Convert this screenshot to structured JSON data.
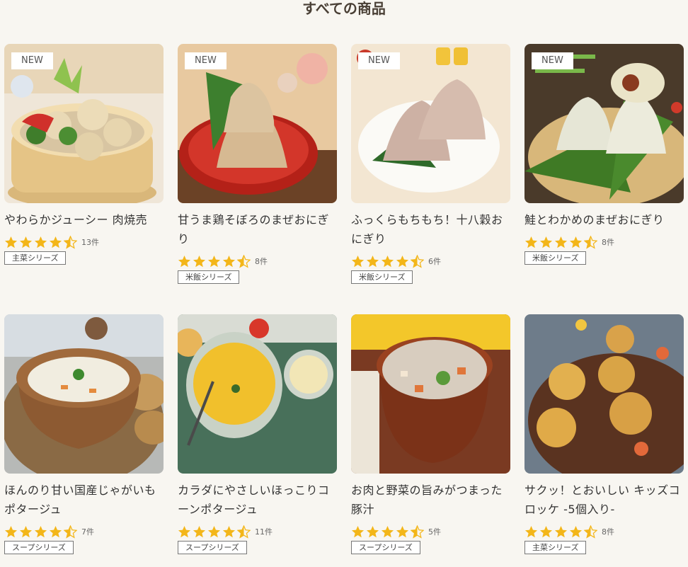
{
  "page_title": "すべての商品",
  "products": [
    {
      "name": "やわらかジューシー 肉焼売",
      "badge": "NEW",
      "rating": 4.5,
      "count": "13件",
      "tag": "主菜シリーズ",
      "img": "shumai"
    },
    {
      "name": "甘うま鶏そぼろのまぜおにぎり",
      "badge": "NEW",
      "rating": 4.5,
      "count": "8件",
      "tag": "米飯シリーズ",
      "img": "onigiri-red"
    },
    {
      "name": "ふっくらもちもち！十八穀おにぎり",
      "badge": "NEW",
      "rating": 4.5,
      "count": "6件",
      "tag": "米飯シリーズ",
      "img": "onigiri-white"
    },
    {
      "name": "鮭とわかめのまぜおにぎり",
      "badge": "NEW",
      "rating": 4.5,
      "count": "8件",
      "tag": "米飯シリーズ",
      "img": "onigiri-bamboo"
    },
    {
      "name": "ほんのり甘い国産じゃがいもポタージュ",
      "badge": "",
      "rating": 4.5,
      "count": "7件",
      "tag": "スープシリーズ",
      "img": "potato-soup"
    },
    {
      "name": "カラダにやさしいほっこりコーンポタージュ",
      "badge": "",
      "rating": 4.5,
      "count": "11件",
      "tag": "スープシリーズ",
      "img": "corn-soup"
    },
    {
      "name": "お肉と野菜の旨みがつまった豚汁",
      "badge": "",
      "rating": 4.5,
      "count": "5件",
      "tag": "スープシリーズ",
      "img": "tonjiru"
    },
    {
      "name": "サクッ！とおいしい キッズコロッケ -5個入り-",
      "badge": "",
      "rating": 4.5,
      "count": "8件",
      "tag": "主菜シリーズ",
      "img": "croquette"
    }
  ],
  "colors": {
    "star": "#f3b619",
    "background": "#f8f6f1"
  }
}
